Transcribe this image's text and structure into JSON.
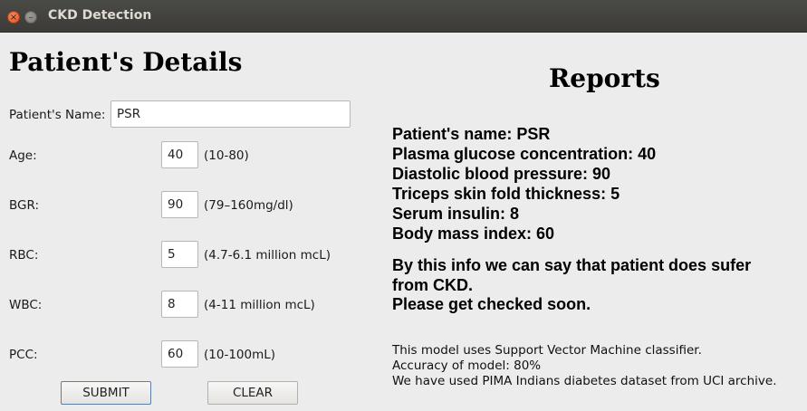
{
  "window": {
    "title": "CKD Detection",
    "close_glyph": "×",
    "minimize_glyph": "–"
  },
  "form": {
    "heading": "Patient's Details",
    "name": {
      "label": "Patient's Name:",
      "value": "PSR"
    },
    "fields": [
      {
        "label": "Age:",
        "value": "40",
        "hint": "(10-80)"
      },
      {
        "label": "BGR:",
        "value": "90",
        "hint": "(79–160mg/dl)"
      },
      {
        "label": "RBC:",
        "value": "5",
        "hint": "(4.7-6.1 million mcL)"
      },
      {
        "label": "WBC:",
        "value": "8",
        "hint": "(4-11 million mcL)"
      },
      {
        "label": "PCC:",
        "value": "60",
        "hint": "(10-100mL)"
      }
    ],
    "submit_label": "SUBMIT",
    "clear_label": "CLEAR"
  },
  "reports": {
    "heading": "Reports",
    "lines": [
      "Patient's name: PSR",
      "Plasma glucose concentration: 40",
      "Diastolic blood pressure: 90",
      "Triceps skin fold thickness: 5",
      "Serum insulin: 8",
      "Body mass index: 60"
    ],
    "conclusion": [
      "By this info we can say that patient does sufer",
      "from CKD.",
      "Please get checked soon."
    ],
    "notes": [
      "This model uses Support Vector Machine classifier.",
      "Accuracy of model: 80%",
      "We have used PIMA Indians diabetes dataset from UCI archive."
    ]
  }
}
